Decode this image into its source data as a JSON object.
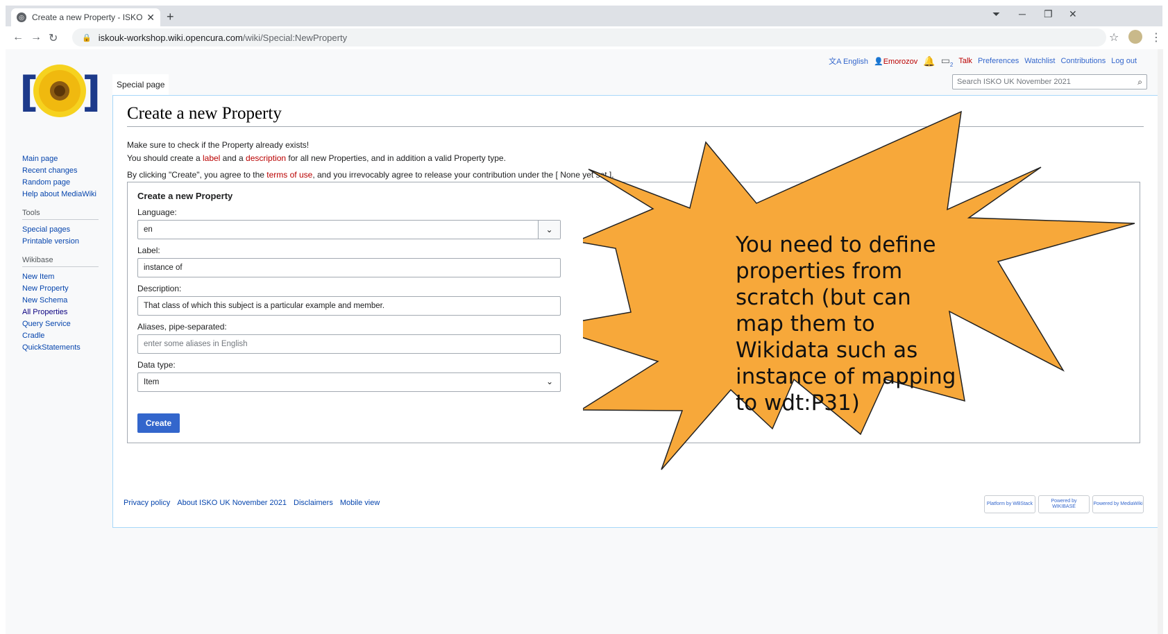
{
  "browser": {
    "tab_title": "Create a new Property - ISKO UK",
    "url_host": "iskouk-workshop.wiki.opencura.com",
    "url_path": "/wiki/Special:NewProperty"
  },
  "personal": {
    "language": "English",
    "user": "Emorozov",
    "notice_count": "2",
    "links": [
      "Talk",
      "Preferences",
      "Watchlist",
      "Contributions",
      "Log out"
    ]
  },
  "special_tab": "Special page",
  "search_placeholder": "Search ISKO UK November 2021",
  "sidebar": {
    "nav": [
      "Main page",
      "Recent changes",
      "Random page",
      "Help about MediaWiki"
    ],
    "tools_heading": "Tools",
    "tools": [
      "Special pages",
      "Printable version"
    ],
    "wikibase_heading": "Wikibase",
    "wikibase": [
      "New Item",
      "New Property",
      "New Schema",
      "All Properties",
      "Query Service",
      "Cradle",
      "QuickStatements"
    ]
  },
  "page": {
    "title": "Create a new Property",
    "line1": "Make sure to check if the Property already exists!",
    "line2_a": "You should create a ",
    "line2_label": "label",
    "line2_b": " and a ",
    "line2_desc": "description",
    "line2_c": " for all new Properties, and in addition a valid Property type.",
    "line3_a": "By clicking \"Create\", you agree to the ",
    "line3_terms": "terms of use",
    "line3_b": ", and you irrevocably agree to release your contribution under the [ None yet set.]."
  },
  "form": {
    "legend": "Create a new Property",
    "language_label": "Language:",
    "language_value": "en",
    "label_label": "Label:",
    "label_value": "instance of",
    "description_label": "Description:",
    "description_value": "That class of which this subject is a particular example and member.",
    "aliases_label": "Aliases, pipe-separated:",
    "aliases_placeholder": "enter some aliases in English",
    "datatype_label": "Data type:",
    "datatype_value": "Item",
    "create_label": "Create"
  },
  "footer": [
    "Privacy policy",
    "About ISKO UK November 2021",
    "Disclaimers",
    "Mobile view"
  ],
  "badges": [
    "Platform by WBStack",
    "Powered by WIKIBASE",
    "Powered by MediaWiki"
  ],
  "callout": {
    "text": "You need to define properties from scratch (but can map them to Wikidata such as instance of mapping to wdt:P31)",
    "fill": "#f7a83a"
  }
}
